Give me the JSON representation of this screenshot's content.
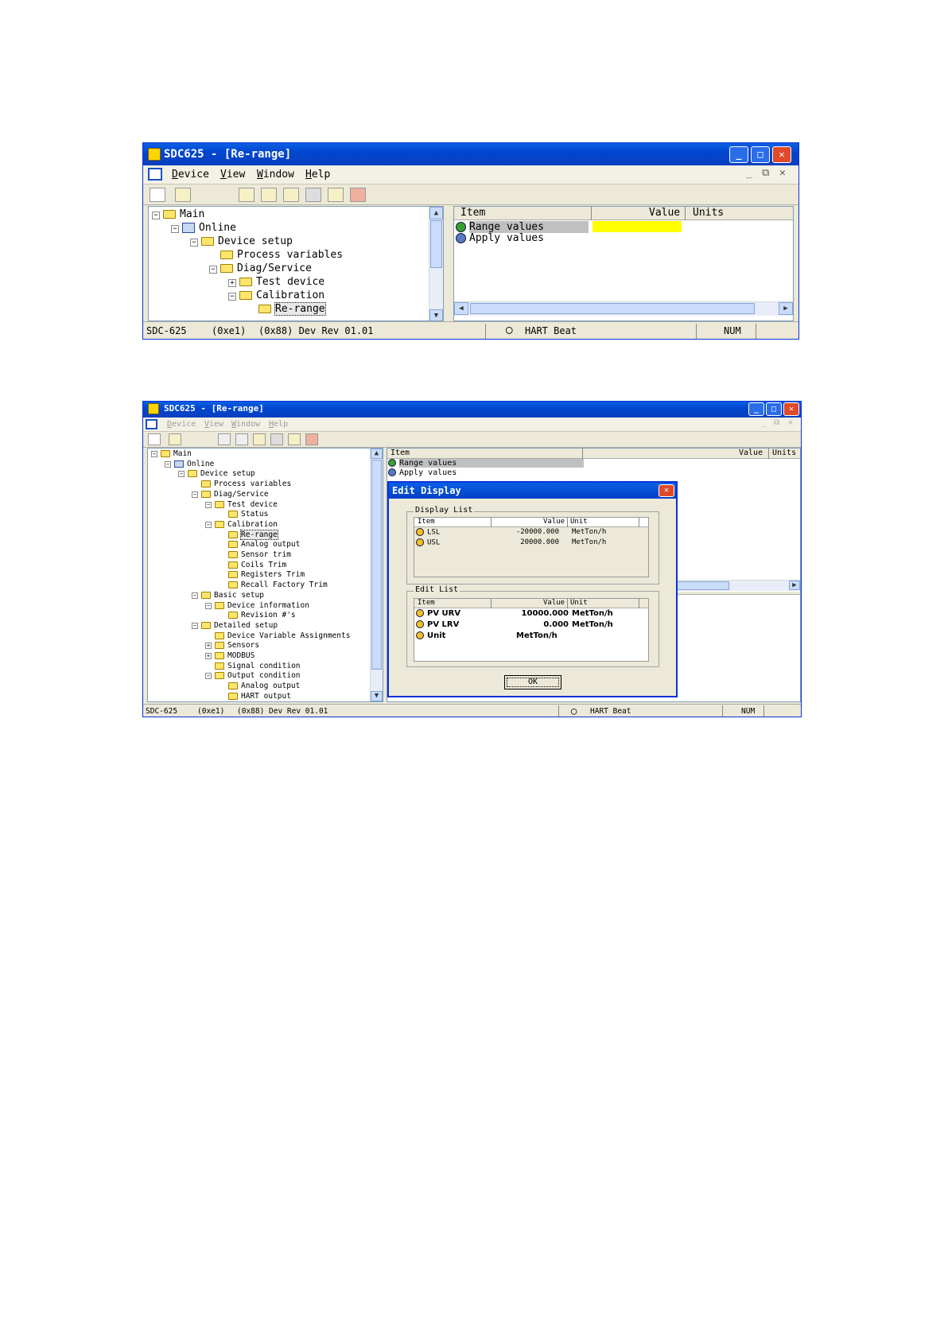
{
  "window1": {
    "title": "SDC625 - [Re-range]",
    "menu": [
      {
        "key": "D",
        "rest": "evice"
      },
      {
        "key": "V",
        "rest": "iew"
      },
      {
        "key": "W",
        "rest": "indow"
      },
      {
        "key": "H",
        "rest": "elp"
      }
    ],
    "tree": [
      "Main",
      "Online",
      "Device setup",
      "Process variables",
      "Diag/Service",
      "Test device",
      "Calibration",
      "Re-range"
    ],
    "list_header": {
      "item": "Item",
      "value": "Value",
      "units": "Units"
    },
    "rows": [
      "Range values",
      "Apply values"
    ],
    "status": {
      "device": "SDC-625",
      "code1": "(0xe1)",
      "code2": "(0x88) Dev Rev 01.01",
      "hart": "HART Beat",
      "num": "NUM"
    },
    "colors": {
      "highlight": "#ffff00"
    }
  },
  "window2": {
    "title": "SDC625 - [Re-range]",
    "menu": [
      {
        "key": "D",
        "rest": "evice"
      },
      {
        "key": "V",
        "rest": "iew"
      },
      {
        "key": "W",
        "rest": "indow"
      },
      {
        "key": "H",
        "rest": "elp"
      }
    ],
    "tree": [
      "Main",
      "Online",
      "Device setup",
      "Process variables",
      "Diag/Service",
      "Test device",
      "Status",
      "Calibration",
      "Re-range",
      "Analog output",
      "Sensor trim",
      "Coils Trim",
      "Registers Trim",
      "Recall Factory Trim",
      "Basic setup",
      "Device information",
      "Revision #'s",
      "Detailed setup",
      "Device Variable Assignments",
      "Sensors",
      "MODBUS",
      "Signal condition",
      "Output condition",
      "Analog output",
      "HART output"
    ],
    "list_header": {
      "item": "Item",
      "value": "Value",
      "units": "Units"
    },
    "rows": [
      "Range values",
      "Apply values"
    ],
    "status": {
      "device": "SDC-625",
      "code1": "(0xe1)",
      "code2": "(0x88) Dev Rev 01.01",
      "hart": "HART Beat",
      "num": "NUM"
    }
  },
  "dialog": {
    "title": "Edit Display",
    "display_list": {
      "label": "Display List",
      "header": {
        "item": "Item",
        "value": "Value",
        "unit": "Unit"
      },
      "rows": [
        {
          "item": "LSL",
          "value": "-20000.000",
          "unit": "MetTon/h"
        },
        {
          "item": "USL",
          "value": "20000.000",
          "unit": "MetTon/h"
        }
      ]
    },
    "edit_list": {
      "label": "Edit List",
      "header": {
        "item": "Item",
        "value": "Value",
        "unit": "Unit"
      },
      "rows": [
        {
          "item": "PV URV",
          "value": "10000.000",
          "unit": "MetTon/h"
        },
        {
          "item": "PV LRV",
          "value": "0.000",
          "unit": "MetTon/h"
        },
        {
          "item": "Unit",
          "value": "MetTon/h",
          "unit": ""
        }
      ]
    },
    "ok_label": "OK"
  }
}
